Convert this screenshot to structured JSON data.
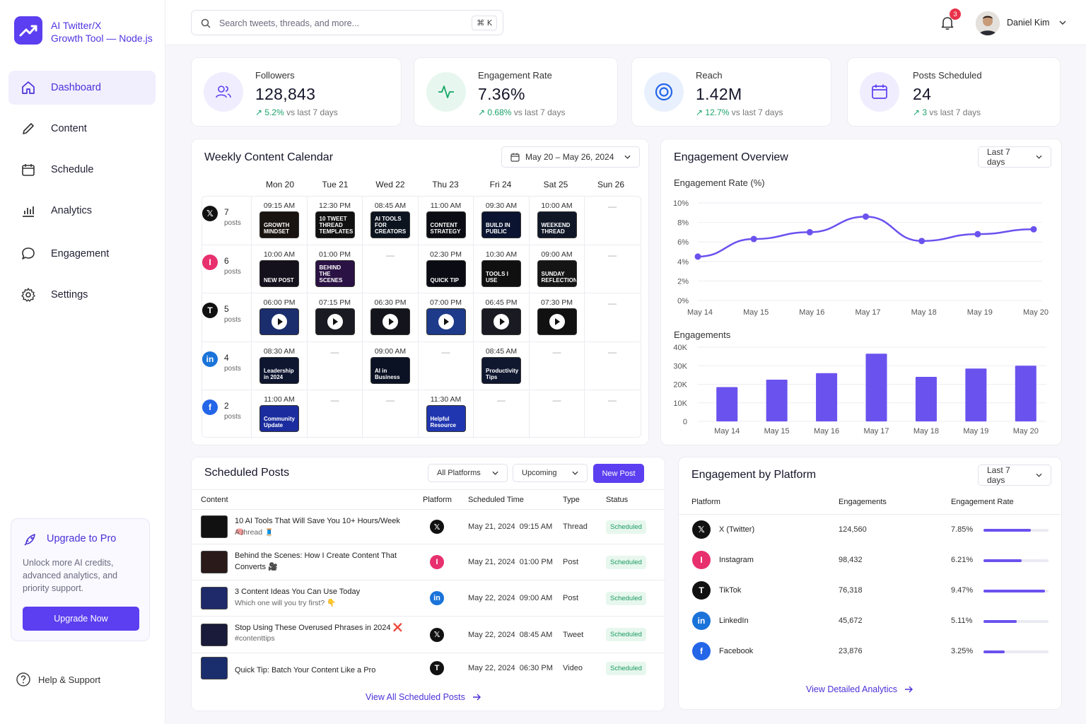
{
  "brand": {
    "line1": "AI Twitter/X",
    "line2": "Growth Tool — Node.js"
  },
  "nav": [
    {
      "label": "Dashboard",
      "icon": "home-icon"
    },
    {
      "label": "Content",
      "icon": "pencil-icon"
    },
    {
      "label": "Schedule",
      "icon": "calendar-icon"
    },
    {
      "label": "Analytics",
      "icon": "bar-chart-icon"
    },
    {
      "label": "Engagement",
      "icon": "chat-icon"
    },
    {
      "label": "Settings",
      "icon": "gear-icon"
    }
  ],
  "upgrade": {
    "title": "Upgrade to Pro",
    "desc": "Unlock more AI credits, advanced analytics, and priority support.",
    "button": "Upgrade Now"
  },
  "help": "Help & Support",
  "search": {
    "placeholder": "Search tweets, threads, and more...",
    "kbd": "⌘ K"
  },
  "notifications": {
    "count": "3"
  },
  "user": {
    "name": "Daniel Kim"
  },
  "stats": [
    {
      "label": "Followers",
      "value": "128,843",
      "change": "5.2%",
      "suffix": "vs last 7 days",
      "icon": "users-icon",
      "color": "#5b3ff0",
      "bg": "#f0edfe"
    },
    {
      "label": "Engagement Rate",
      "value": "7.36%",
      "change": "0.68%",
      "suffix": "vs last 7 days",
      "icon": "pulse-icon",
      "color": "#17a768",
      "bg": "#e7f7ef"
    },
    {
      "label": "Reach",
      "value": "1.42M",
      "change": "12.7%",
      "suffix": "vs last 7 days",
      "icon": "target-icon",
      "color": "#2466e8",
      "bg": "#e9f0fd"
    },
    {
      "label": "Posts Scheduled",
      "value": "24",
      "change": "3",
      "suffix": "vs last 7 days",
      "icon": "calendar-icon",
      "color": "#5b3ff0",
      "bg": "#f0edfe"
    }
  ],
  "calendar": {
    "title": "Weekly Content Calendar",
    "range": "May 20 – May 26, 2024",
    "days": [
      "Mon 20",
      "Tue 21",
      "Wed 22",
      "Thu 23",
      "Fri 24",
      "Sat 25",
      "Sun 26"
    ],
    "rows": [
      {
        "platform": "X",
        "icon": "x-icon",
        "count": "7",
        "unit": "posts",
        "color": "#111",
        "cells": [
          {
            "time": "09:15 AM",
            "text": "GROWTH MINDSET",
            "bg": "#1a1410"
          },
          {
            "time": "12:30 PM",
            "text": "10 TWEET THREAD TEMPLATES",
            "bg": "#111"
          },
          {
            "time": "08:45 AM",
            "text": "AI TOOLS FOR CREATORS",
            "bg": "#0c1420"
          },
          {
            "time": "11:00 AM",
            "text": "CONTENT STRATEGY",
            "bg": "#0c0c14"
          },
          {
            "time": "09:30 AM",
            "text": "BUILD IN PUBLIC",
            "bg": "#0b1430"
          },
          {
            "time": "10:00 AM",
            "text": "WEEKEND THREAD",
            "bg": "#101828"
          },
          null
        ]
      },
      {
        "platform": "Instagram",
        "icon": "instagram-icon",
        "count": "6",
        "unit": "posts",
        "color": "#e8306e",
        "cells": [
          {
            "time": "10:00 AM",
            "text": "NEW POST",
            "bg": "#14101c"
          },
          {
            "time": "01:00 PM",
            "text": "BEHIND THE SCENES",
            "bg": "#2a1244"
          },
          null,
          {
            "time": "02:30 PM",
            "text": "QUICK TIP",
            "bg": "#0b0b14"
          },
          {
            "time": "10:30 AM",
            "text": "TOOLS I USE",
            "bg": "#101010"
          },
          {
            "time": "09:00 AM",
            "text": "SUNDAY REFLECTION",
            "bg": "#151515"
          },
          null
        ]
      },
      {
        "platform": "TikTok",
        "icon": "tiktok-icon",
        "count": "5",
        "unit": "posts",
        "color": "#111",
        "cells": [
          {
            "time": "06:00 PM",
            "video": true,
            "bg": "#1a2e6e"
          },
          {
            "time": "07:15 PM",
            "video": true,
            "bg": "#1a1a22"
          },
          {
            "time": "06:30 PM",
            "video": true,
            "bg": "#14141c"
          },
          {
            "time": "07:00 PM",
            "video": true,
            "bg": "#1e3a8a"
          },
          {
            "time": "06:45 PM",
            "video": true,
            "bg": "#1a1a22"
          },
          {
            "time": "07:30 PM",
            "video": true,
            "bg": "#111"
          },
          null
        ]
      },
      {
        "platform": "LinkedIn",
        "icon": "linkedin-icon",
        "count": "4",
        "unit": "posts",
        "color": "#1a73d9",
        "cells": [
          {
            "time": "08:30 AM",
            "text": "Leadership in 2024",
            "bg": "#0e1630"
          },
          null,
          {
            "time": "09:00 AM",
            "text": "AI in Business",
            "bg": "#0b1224"
          },
          null,
          {
            "time": "08:45 AM",
            "text": "Productivity Tips",
            "bg": "#101830"
          },
          null,
          null
        ]
      },
      {
        "platform": "Facebook",
        "icon": "facebook-icon",
        "count": "2",
        "unit": "posts",
        "color": "#2466e8",
        "cells": [
          {
            "time": "11:00 AM",
            "text": "Community Update",
            "bg": "#1b2c9e"
          },
          null,
          null,
          {
            "time": "11:30 AM",
            "text": "Helpful Resource",
            "bg": "#2036b0"
          },
          null,
          null,
          null
        ]
      }
    ]
  },
  "overview": {
    "title": "Engagement Overview",
    "period": "Last 7 days",
    "line_title": "Engagement Rate (%)",
    "bar_title": "Engagements"
  },
  "chart_data": [
    {
      "type": "line",
      "title": "Engagement Rate (%)",
      "x": [
        "May 14",
        "May 15",
        "May 16",
        "May 17",
        "May 18",
        "May 19",
        "May 20"
      ],
      "values": [
        4.5,
        6.3,
        7.0,
        8.6,
        6.1,
        6.8,
        7.3
      ],
      "ylim": [
        0,
        10
      ],
      "yticks": [
        "0%",
        "2%",
        "4%",
        "6%",
        "8%",
        "10%"
      ],
      "color": "#6a52ef"
    },
    {
      "type": "bar",
      "title": "Engagements",
      "categories": [
        "May 14",
        "May 15",
        "May 16",
        "May 17",
        "May 18",
        "May 19",
        "May 20"
      ],
      "values": [
        18500,
        22500,
        26000,
        36500,
        24000,
        28500,
        30000
      ],
      "ylim": [
        0,
        40000
      ],
      "yticks": [
        "0",
        "10K",
        "20K",
        "30K",
        "40K"
      ],
      "color": "#6a52ef"
    }
  ],
  "scheduled": {
    "title": "Scheduled Posts",
    "filter1": "All Platforms",
    "filter2": "Upcoming",
    "new_post": "New Post",
    "headers": [
      "Content",
      "Platform",
      "Scheduled Time",
      "Type",
      "Status"
    ],
    "rows": [
      {
        "title": "10 AI Tools That Will Save You 10+ Hours/Week 🧠",
        "sub": "A thread 🧵",
        "platform": "x-icon",
        "time": "May 21, 2024  09:15 AM",
        "type": "Thread",
        "status": "Scheduled",
        "pcolor": "#111",
        "pchar": "𝕏",
        "tbg": "#111"
      },
      {
        "title": "Behind the Scenes: How I Create Content That Converts 🎥",
        "sub": "",
        "platform": "instagram-icon",
        "time": "May 21, 2024  01:00 PM",
        "type": "Post",
        "status": "Scheduled",
        "pcolor": "#e8306e",
        "pchar": "I",
        "tbg": "#2a1a1a"
      },
      {
        "title": "3 Content Ideas You Can Use Today",
        "sub": "Which one will you try first? 👇",
        "platform": "linkedin-icon",
        "time": "May 22, 2024  09:00 AM",
        "type": "Post",
        "status": "Scheduled",
        "pcolor": "#1a73d9",
        "pchar": "in",
        "tbg": "#1e2a6a"
      },
      {
        "title": "Stop Using These Overused Phrases in 2024 ❌",
        "sub": "#contenttips",
        "platform": "x-icon",
        "time": "May 22, 2024  08:45 AM",
        "type": "Tweet",
        "status": "Scheduled",
        "pcolor": "#111",
        "pchar": "𝕏",
        "tbg": "#1a1a3a"
      },
      {
        "title": "Quick Tip: Batch Your Content Like a Pro",
        "sub": "",
        "platform": "tiktok-icon",
        "time": "May 22, 2024  06:30 PM",
        "type": "Video",
        "status": "Scheduled",
        "pcolor": "#111",
        "pchar": "T",
        "tbg": "#1a2e6e"
      }
    ],
    "view_all": "View All Scheduled Posts"
  },
  "by_platform": {
    "title": "Engagement by Platform",
    "period": "Last 7 days",
    "headers": [
      "Platform",
      "Engagements",
      "Engagement Rate"
    ],
    "rows": [
      {
        "name": "X (Twitter)",
        "engagements": "124,560",
        "rate": "7.85%",
        "rate_value": 0.73,
        "color": "#111",
        "char": "𝕏"
      },
      {
        "name": "Instagram",
        "engagements": "98,432",
        "rate": "6.21%",
        "rate_value": 0.59,
        "color": "#e8306e",
        "char": "I"
      },
      {
        "name": "TikTok",
        "engagements": "76,318",
        "rate": "9.47%",
        "rate_value": 0.95,
        "color": "#111",
        "char": "T"
      },
      {
        "name": "LinkedIn",
        "engagements": "45,672",
        "rate": "5.11%",
        "rate_value": 0.51,
        "color": "#1a73d9",
        "char": "in"
      },
      {
        "name": "Facebook",
        "engagements": "23,876",
        "rate": "3.25%",
        "rate_value": 0.33,
        "color": "#2466e8",
        "char": "f"
      }
    ],
    "view_all": "View Detailed Analytics"
  }
}
